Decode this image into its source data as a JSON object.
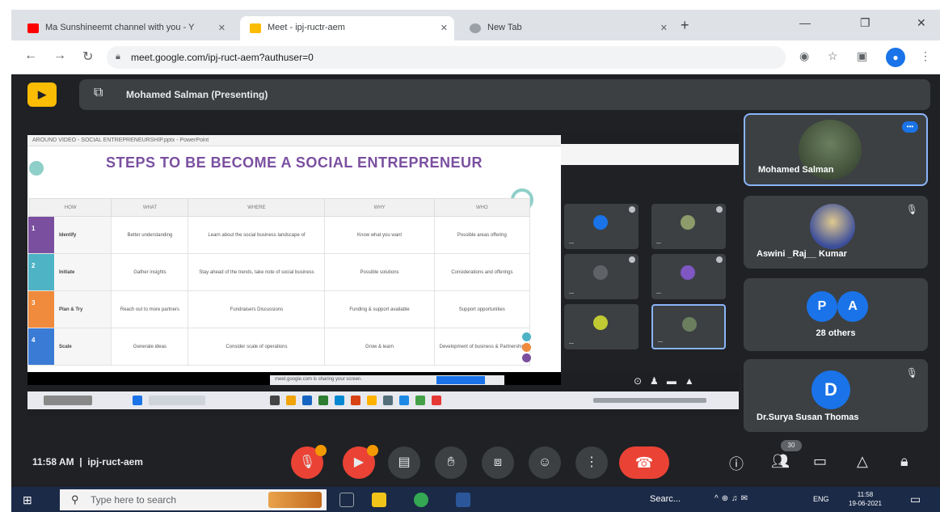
{
  "browser": {
    "tabs": [
      {
        "label": "Ma Sunshineemt channel with you - Y",
        "favicon_color": "#ff0000"
      },
      {
        "label": "Meet - ipj-ructr-aem",
        "favicon_color": "#fbbc04"
      },
      {
        "label": "New Tab",
        "favicon_color": "#9aa0a6"
      }
    ],
    "url": "meet.google.com/ipj-ruct-aem?authuser=0"
  },
  "meet": {
    "logo_icon": "meet-presenting-icon",
    "presenter_label": "Mohamed Salman (Presenting)",
    "meeting_time": "11:58 AM",
    "meeting_code": "ipj-ruct-aem",
    "participants": [
      {
        "name": "Mohamed Salman"
      },
      {
        "name": "Aswini _Raj__ Kumar"
      },
      {
        "avatars": [
          "P",
          "A"
        ],
        "label": "28 others"
      },
      {
        "initial": "D",
        "name": "Dr.Surya Susan Thomas"
      }
    ],
    "people_count": "30"
  },
  "slide": {
    "window_title": "AROUND VIDEO - SOCIAL ENTREPRENEURSHIP.pptx - PowerPoint",
    "title": "STEPS TO BE BECOME A SOCIAL ENTREPRENEUR",
    "headers": [
      "HOW",
      "WHAT",
      "WHERE",
      "WHY",
      "WHO"
    ],
    "rows": [
      {
        "num": "1",
        "color": "#7a4fa0",
        "step": "Identify",
        "cells": [
          "Better understanding",
          "Learn about the social business landscape of",
          "Know what you want",
          "Possible areas offering"
        ]
      },
      {
        "num": "2",
        "color": "#4fb3c6",
        "step": "Initiate",
        "cells": [
          "Gather insights",
          "Stay ahead of the trends, take note of social business",
          "Possible solutions",
          "Considerations and offerings"
        ]
      },
      {
        "num": "3",
        "color": "#f08a3c",
        "step": "Plan & Try",
        "cells": [
          "Reach out to more partners",
          "Fundraisers Discussions",
          "Funding & support available",
          "Support opportunities"
        ]
      },
      {
        "num": "4",
        "color": "#3a7bd5",
        "step": "Scale",
        "cells": [
          "Generate ideas",
          "Consider scale of operations",
          "Grow & learn",
          "Development of business & Partnership"
        ]
      }
    ],
    "caption": "meet.google.com is sharing your screen."
  },
  "taskbar": {
    "search_placeholder": "Type here to search",
    "tray_app": "Searc...",
    "lang": "ENG",
    "time": "11:58",
    "date": "19-06-2021"
  }
}
